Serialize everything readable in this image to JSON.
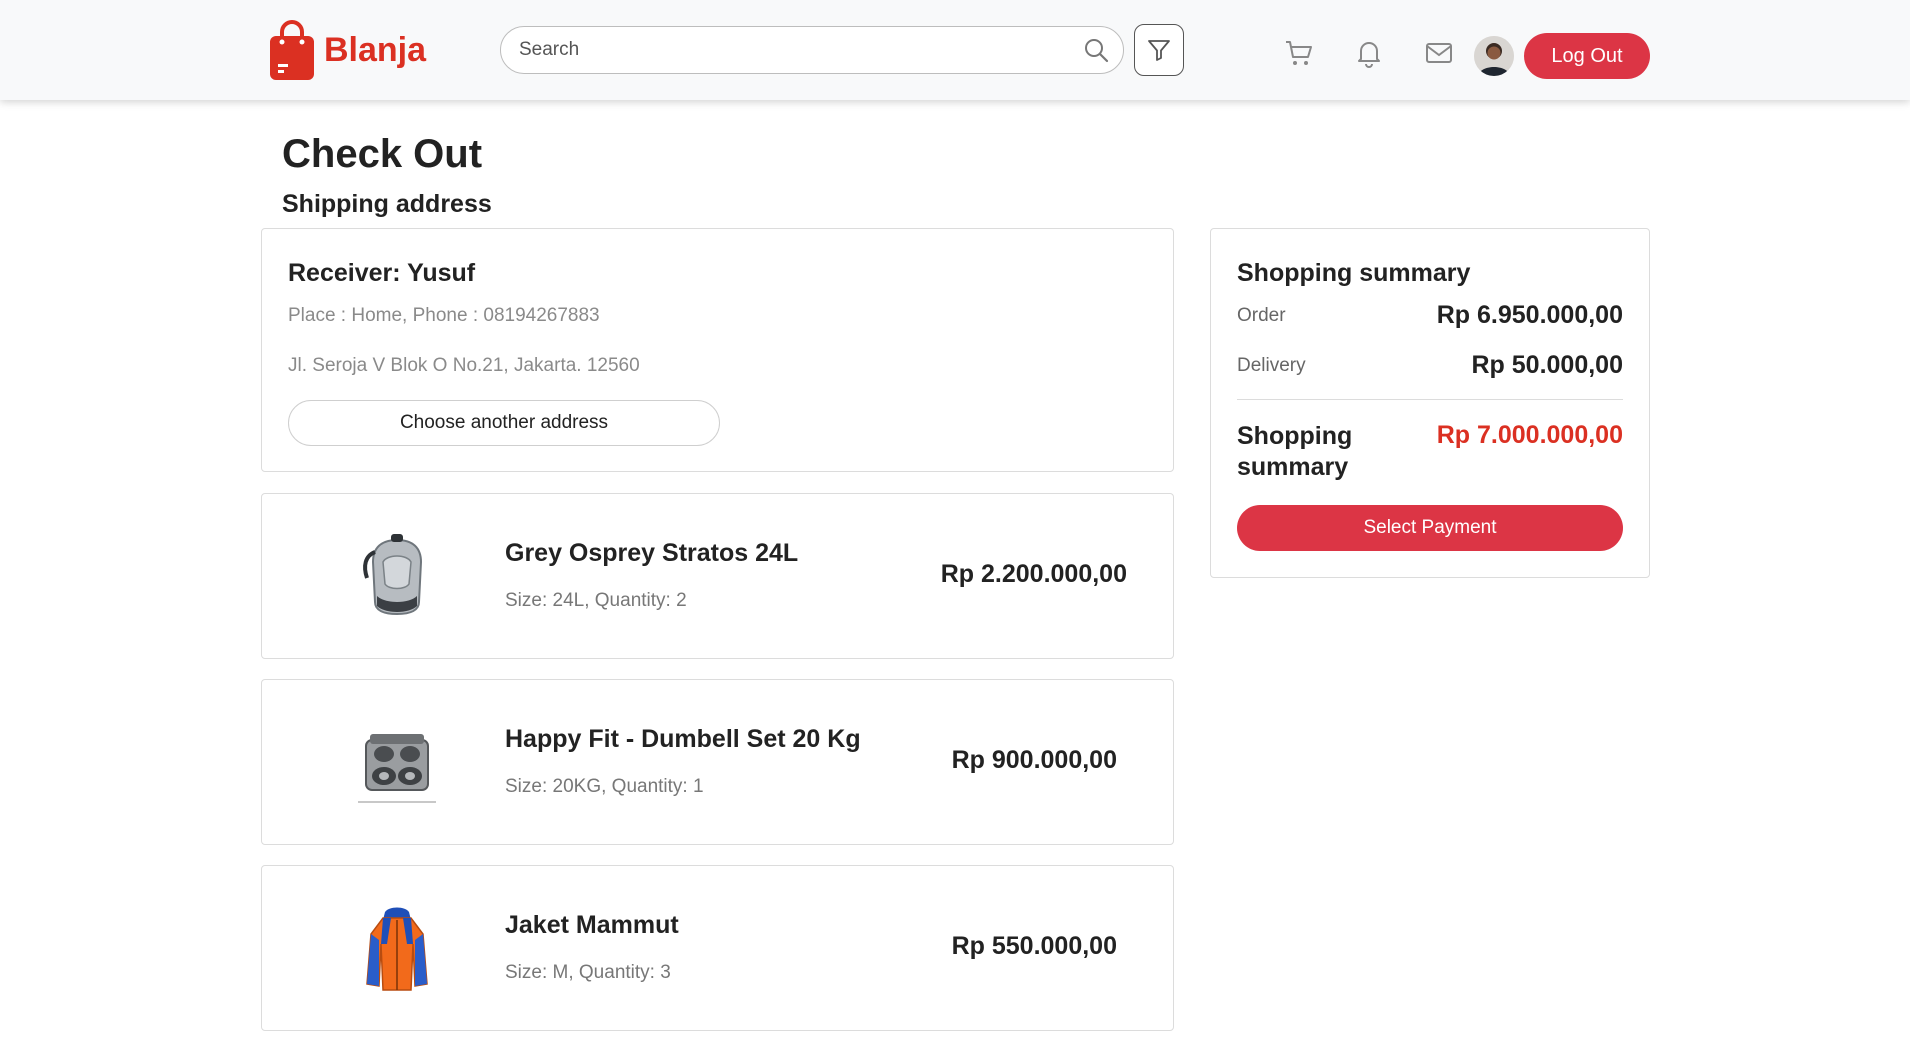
{
  "brand": {
    "name": "Blanja",
    "accent_color": "#db3022"
  },
  "header": {
    "search_placeholder": "Search",
    "icons": [
      "search-icon",
      "filter-icon",
      "cart-icon",
      "bell-icon",
      "mail-icon"
    ],
    "logout_label": "Log Out"
  },
  "page": {
    "title": "Check Out",
    "section_title": "Shipping address"
  },
  "address": {
    "receiver": "Receiver: Yusuf",
    "place_phone": "Place : Home, Phone : 08194267883",
    "street": "Jl. Seroja V Blok O No.21, Jakarta. 12560",
    "choose_label": "Choose another address"
  },
  "items": [
    {
      "name": "Grey Osprey Stratos 24L",
      "meta": "Size: 24L, Quantity: 2",
      "price": "Rp 2.200.000,00",
      "image_icon": "backpack-image"
    },
    {
      "name": "Happy Fit - Dumbell Set 20 Kg",
      "meta": "Size: 20KG, Quantity: 1",
      "price": "Rp 900.000,00",
      "image_icon": "dumbbell-set-image"
    },
    {
      "name": "Jaket Mammut",
      "meta": "Size: M, Quantity: 3",
      "price": "Rp 550.000,00",
      "image_icon": "jacket-image"
    }
  ],
  "summary": {
    "title": "Shopping summary",
    "order_label": "Order",
    "order_value": "Rp 6.950.000,00",
    "delivery_label": "Delivery",
    "delivery_value": "Rp 50.000,00",
    "total_label": "Shopping summary",
    "total_value": "Rp 7.000.000,00",
    "pay_label": "Select Payment"
  }
}
